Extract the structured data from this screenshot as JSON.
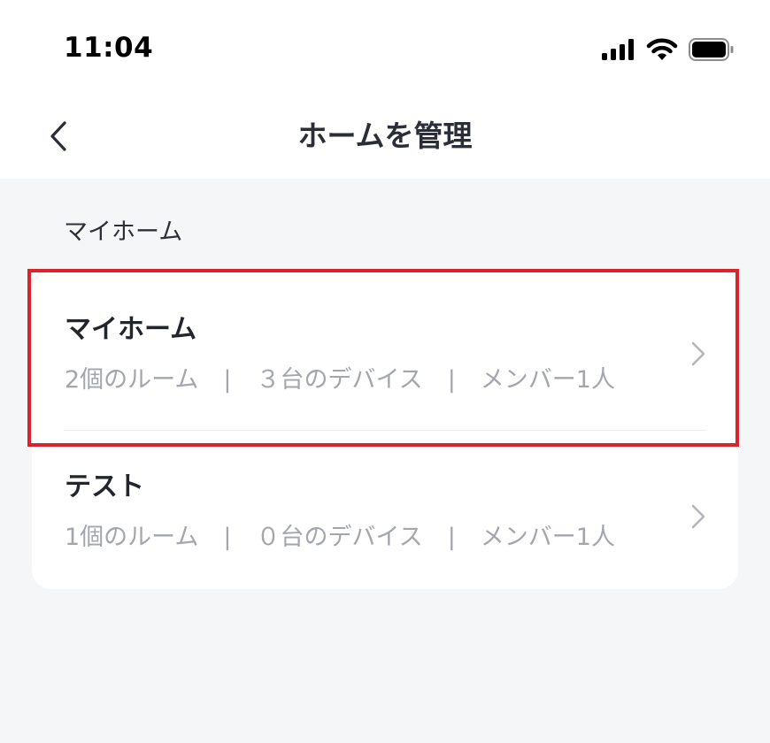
{
  "status_bar": {
    "time": "11:04",
    "icons": [
      "signal-icon",
      "wifi-icon",
      "battery-icon"
    ]
  },
  "nav": {
    "back_icon": "chevron-left-icon",
    "title": "ホームを管理"
  },
  "section": {
    "label": "マイホーム"
  },
  "homes": [
    {
      "name": "マイホーム",
      "rooms": "2個のルーム",
      "devices": "３台のデバイス",
      "members": "メンバー1人",
      "separator": "|"
    },
    {
      "name": "テスト",
      "rooms": "1個のルーム",
      "devices": "０台のデバイス",
      "members": "メンバー1人",
      "separator": "|"
    }
  ],
  "colors": {
    "background": "#f5f6f8",
    "card": "#ffffff",
    "title_text": "#22252e",
    "meta_text": "#a3a6ad",
    "highlight": "#d9232d"
  }
}
